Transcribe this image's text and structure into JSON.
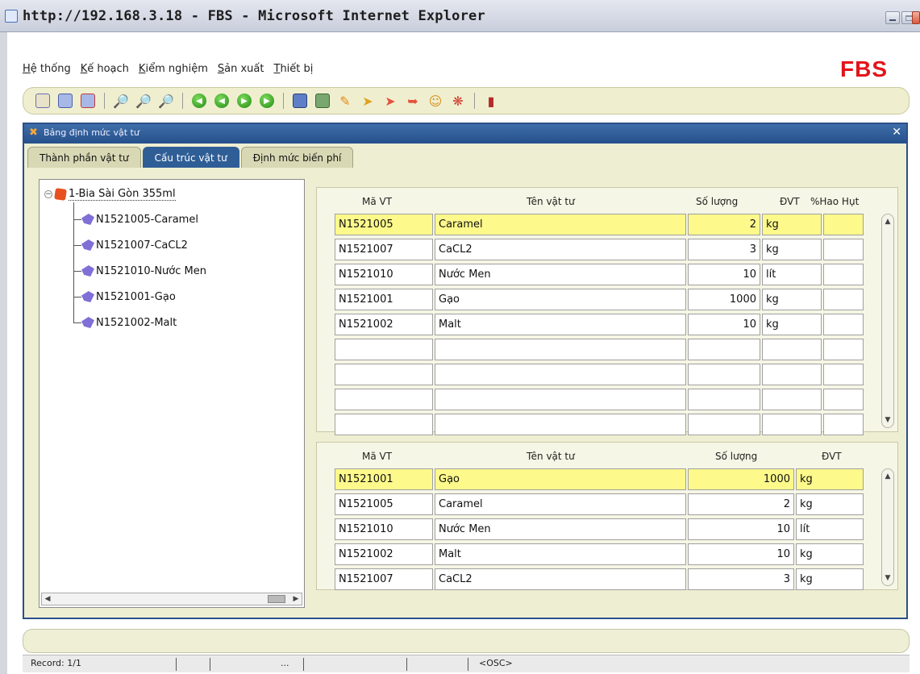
{
  "window": {
    "title": "http://192.168.3.18 - FBS - Microsoft Internet Explorer"
  },
  "menu": {
    "items": [
      "Hệ thống",
      "Kế hoạch",
      "Kiểm nghiệm",
      "Sản xuất",
      "Thiết bị"
    ]
  },
  "brand": "FBS",
  "toolbar": {
    "icons": [
      "new-icon",
      "save-icon",
      "delete-icon",
      "search-icon",
      "search-next-icon",
      "search-clear-icon",
      "first-record-icon",
      "prev-record-icon",
      "next-record-icon",
      "last-record-icon",
      "print-icon",
      "export-icon",
      "tool-a-icon",
      "tool-b-icon",
      "tool-c-icon",
      "tool-d-icon",
      "users-icon",
      "help-icon",
      "exit-icon"
    ]
  },
  "inner_window": {
    "title": "Bảng định mức vật tư",
    "tabs": [
      "Thành phần vật tư",
      "Cấu trúc vật tư",
      "Định mức biến phí"
    ],
    "active_tab": 1
  },
  "tree": {
    "root": "1-Bia Sài Gòn 355ml",
    "children": [
      "N1521005-Caramel",
      "N1521007-CaCL2",
      "N1521010-Nước Men",
      "N1521001-Gạo",
      "N1521002-Malt"
    ]
  },
  "top_grid": {
    "headers": {
      "code": "Mã VT",
      "name": "Tên vật tư",
      "qty": "Số lượng",
      "unit": "ĐVT",
      "loss": "%Hao Hụt"
    },
    "rows": [
      {
        "code": "N1521005",
        "name": "Caramel",
        "qty": "2",
        "unit": "kg",
        "loss": ""
      },
      {
        "code": "N1521007",
        "name": "CaCL2",
        "qty": "3",
        "unit": "kg",
        "loss": ""
      },
      {
        "code": "N1521010",
        "name": "Nước Men",
        "qty": "10",
        "unit": "lít",
        "loss": ""
      },
      {
        "code": "N1521001",
        "name": "Gạo",
        "qty": "1000",
        "unit": "kg",
        "loss": ""
      },
      {
        "code": "N1521002",
        "name": "Malt",
        "qty": "10",
        "unit": "kg",
        "loss": ""
      },
      {
        "code": "",
        "name": "",
        "qty": "",
        "unit": "",
        "loss": ""
      },
      {
        "code": "",
        "name": "",
        "qty": "",
        "unit": "",
        "loss": ""
      },
      {
        "code": "",
        "name": "",
        "qty": "",
        "unit": "",
        "loss": ""
      },
      {
        "code": "",
        "name": "",
        "qty": "",
        "unit": "",
        "loss": ""
      }
    ]
  },
  "bottom_grid": {
    "headers": {
      "code": "Mã VT",
      "name": "Tên vật tư",
      "qty": "Số lượng",
      "unit": "ĐVT"
    },
    "rows": [
      {
        "code": "N1521001",
        "name": "Gạo",
        "qty": "1000",
        "unit": "kg"
      },
      {
        "code": "N1521005",
        "name": "Caramel",
        "qty": "2",
        "unit": "kg"
      },
      {
        "code": "N1521010",
        "name": "Nước Men",
        "qty": "10",
        "unit": "lít"
      },
      {
        "code": "N1521002",
        "name": "Malt",
        "qty": "10",
        "unit": "kg"
      },
      {
        "code": "N1521007",
        "name": "CaCL2",
        "qty": "3",
        "unit": "kg"
      }
    ]
  },
  "status": {
    "record": "Record: 1/1",
    "dots": "...",
    "osc": "<OSC>"
  },
  "colors": {
    "selected_row": "#fdf98b",
    "inner_title": "#2f5e97",
    "brand": "#e3141b"
  }
}
